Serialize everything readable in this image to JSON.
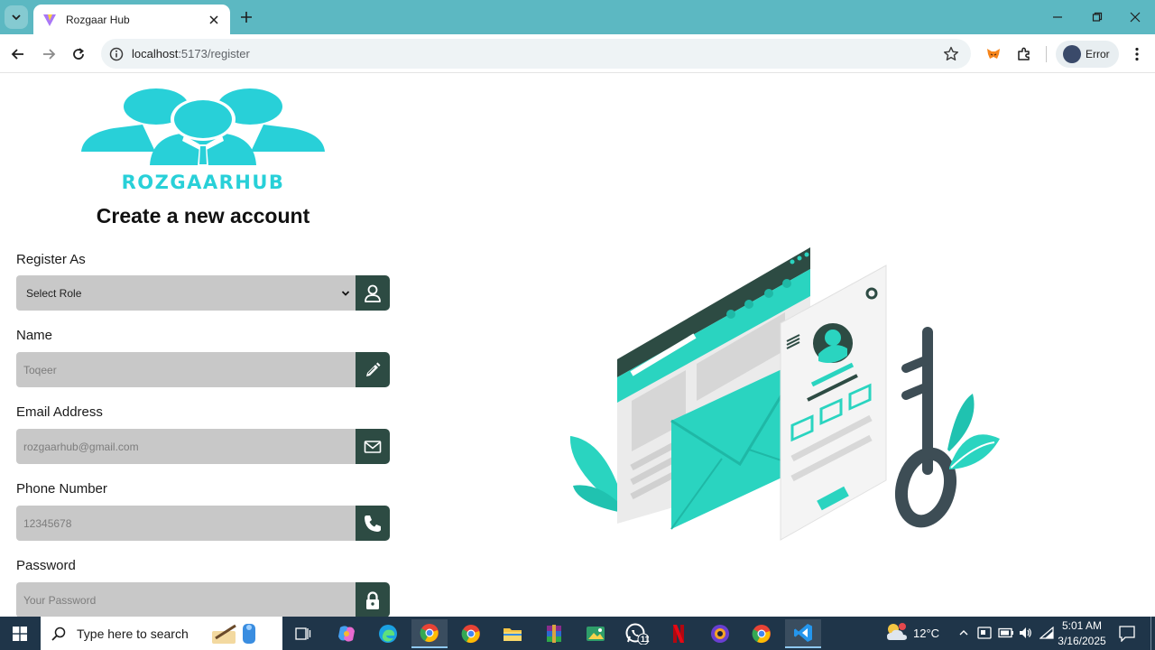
{
  "browser": {
    "tab_title": "Rozgaar Hub",
    "url_host": "localhost",
    "url_rest": ":5173/register",
    "profile_label": "Error"
  },
  "page": {
    "logo_text": "ROZGAARHUB",
    "title": "Create a new account",
    "fields": {
      "role": {
        "label": "Register As",
        "value": "Select Role",
        "icon": "user-icon"
      },
      "name": {
        "label": "Name",
        "placeholder": "Toqeer",
        "icon": "pencil-icon"
      },
      "email": {
        "label": "Email Address",
        "placeholder": "rozgaarhub@gmail.com",
        "icon": "envelope-icon"
      },
      "phone": {
        "label": "Phone Number",
        "placeholder": "12345678",
        "icon": "phone-icon"
      },
      "password": {
        "label": "Password",
        "placeholder": "Your Password",
        "icon": "lock-icon"
      }
    }
  },
  "colors": {
    "brand_teal": "#28d0d8",
    "icon_button": "#2d4b43",
    "input_bg": "#c8c8c8",
    "tab_strip": "#5cb8c2"
  },
  "taskbar": {
    "search_placeholder": "Type here to search",
    "weather": "12°C",
    "whatsapp_badge": "11",
    "time": "5:01 AM",
    "date": "3/16/2025"
  }
}
